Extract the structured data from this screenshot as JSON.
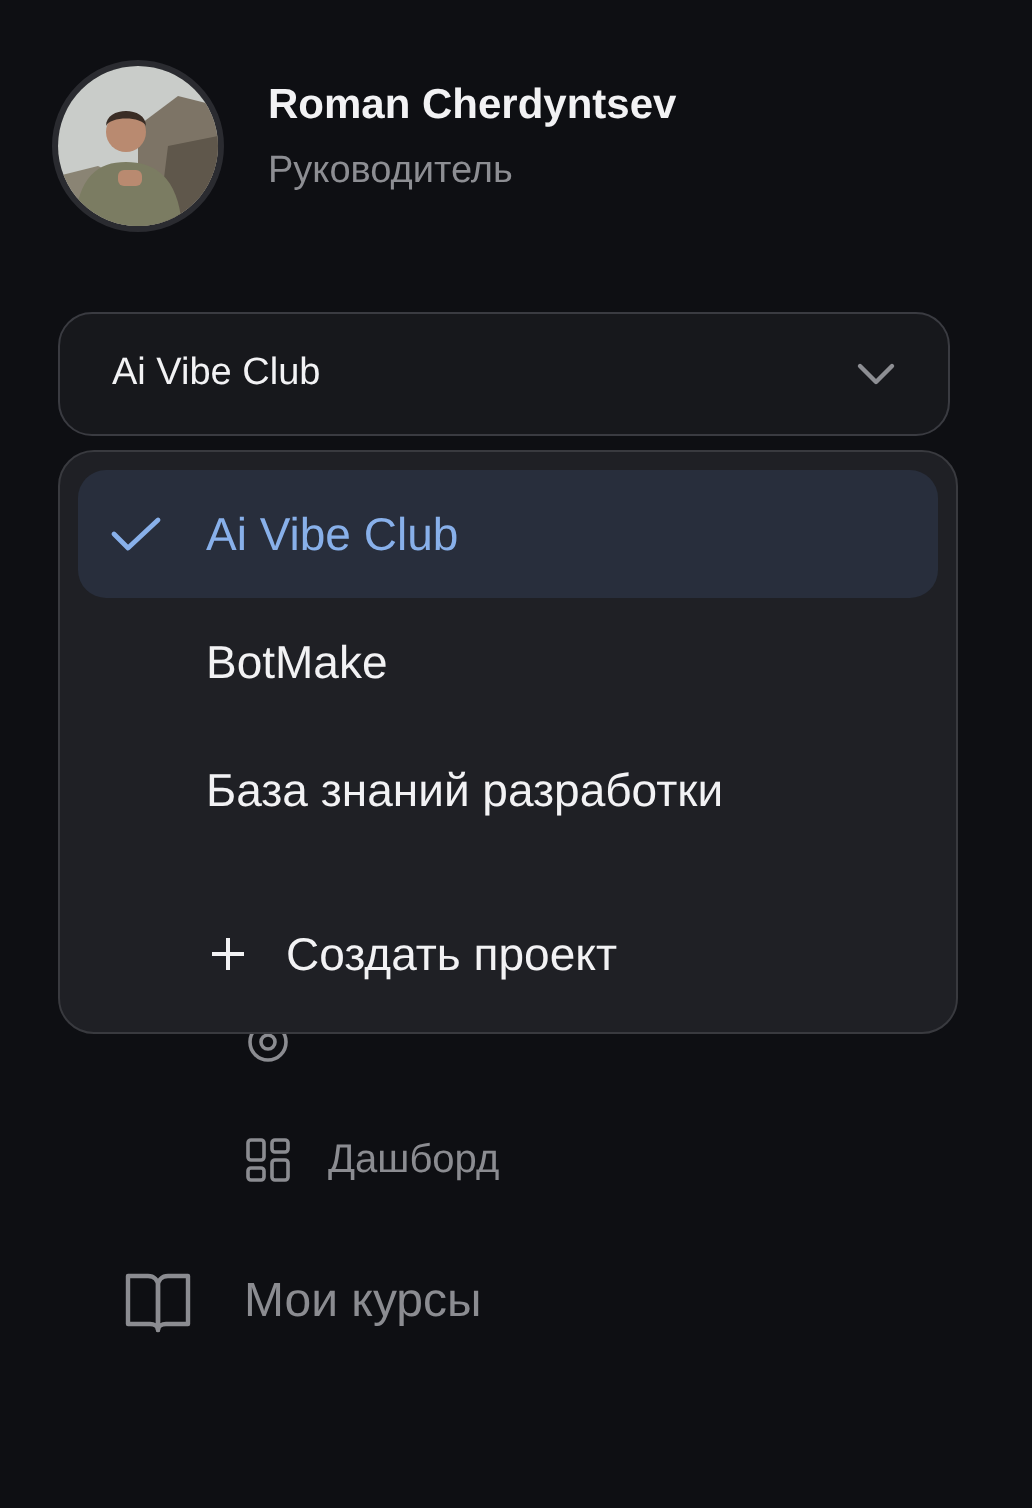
{
  "user": {
    "name": "Roman Cherdyntsev",
    "role": "Руководитель"
  },
  "project_select": {
    "value": "Ai Vibe Club",
    "expanded": true
  },
  "dropdown": {
    "items": [
      {
        "label": "Ai Vibe Club",
        "selected": true
      },
      {
        "label": "BotMake",
        "selected": false
      },
      {
        "label": "База знаний разработки",
        "selected": false
      }
    ],
    "create_action": {
      "label": "Создать проект"
    }
  },
  "nav": {
    "items": [
      {
        "kind": "sub"
      },
      {
        "label": "Дашборд",
        "kind": "sub"
      },
      {
        "label": "Мои курсы",
        "kind": "main"
      }
    ]
  }
}
